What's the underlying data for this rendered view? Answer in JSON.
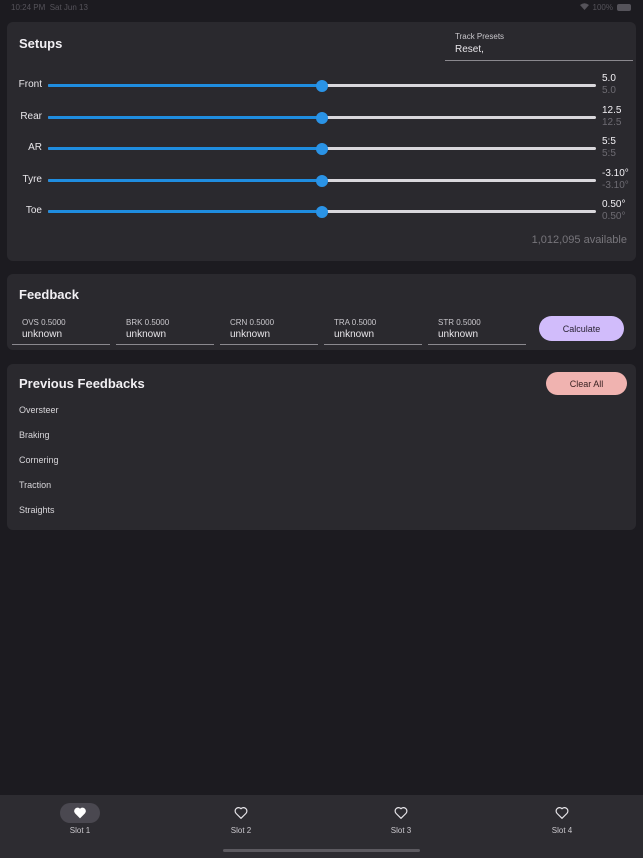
{
  "status": {
    "time": "10:24 PM",
    "date": "Sat Jun 13",
    "battery": "100%"
  },
  "setups": {
    "title": "Setups",
    "preset_label": "Track Presets",
    "preset_value": "Reset,",
    "sliders": [
      {
        "label": "Front",
        "value": "5.0",
        "sub": "5.0",
        "fraction": 0.5
      },
      {
        "label": "Rear",
        "value": "12.5",
        "sub": "12.5",
        "fraction": 0.5
      },
      {
        "label": "AR",
        "value": "5:5",
        "sub": "5:5",
        "fraction": 0.5
      },
      {
        "label": "Tyre",
        "value": "-3.10°",
        "sub": "-3.10°",
        "fraction": 0.5
      },
      {
        "label": "Toe",
        "value": "0.50°",
        "sub": "0.50°",
        "fraction": 0.5
      }
    ],
    "available": "1,012,095 available"
  },
  "feedback": {
    "title": "Feedback",
    "fields": [
      {
        "label": "OVS 0.5000",
        "value": "unknown"
      },
      {
        "label": "BRK 0.5000",
        "value": "unknown"
      },
      {
        "label": "CRN 0.5000",
        "value": "unknown"
      },
      {
        "label": "TRA 0.5000",
        "value": "unknown"
      },
      {
        "label": "STR 0.5000",
        "value": "unknown"
      }
    ],
    "calculate_label": "Calculate"
  },
  "previous": {
    "title": "Previous Feedbacks",
    "clear_label": "Clear All",
    "items": [
      "Oversteer",
      "Braking",
      "Cornering",
      "Traction",
      "Straights"
    ]
  },
  "tabs": [
    {
      "label": "Slot 1",
      "icon": "heart-filled-icon",
      "active": true
    },
    {
      "label": "Slot 2",
      "icon": "heart-outline-icon",
      "active": false
    },
    {
      "label": "Slot 3",
      "icon": "heart-outline-icon",
      "active": false
    },
    {
      "label": "Slot 4",
      "icon": "heart-outline-icon",
      "active": false
    }
  ],
  "colors": {
    "background": "#1c1b20",
    "card": "#2a292e",
    "slider_accent": "#1f8de0",
    "calculate_button": "#d1bcfb",
    "clear_button": "#f0b3b0"
  }
}
